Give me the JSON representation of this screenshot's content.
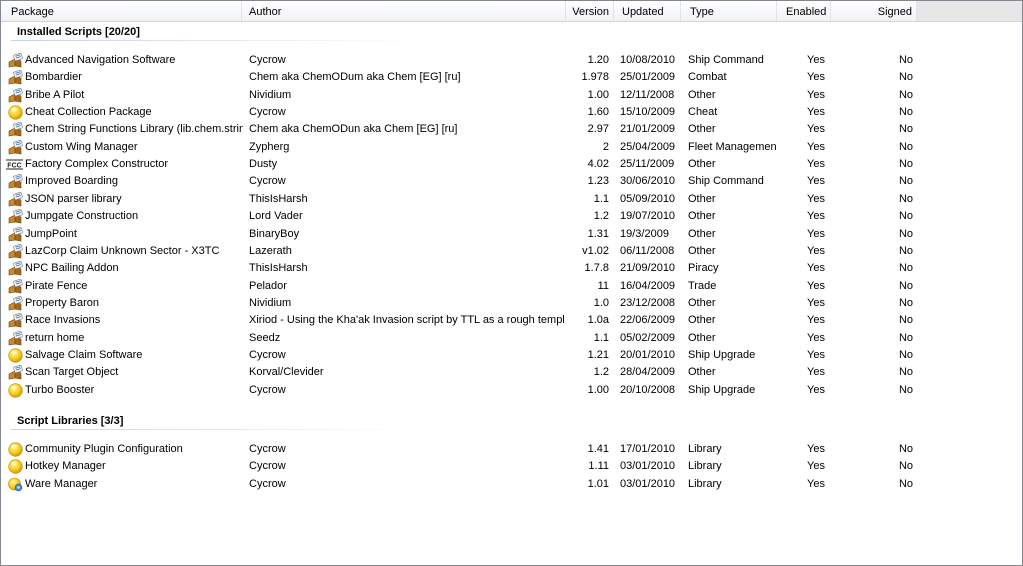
{
  "columns": {
    "package": "Package",
    "author": "Author",
    "version": "Version",
    "updated": "Updated",
    "type": "Type",
    "enabled": "Enabled",
    "signed": "Signed"
  },
  "groups": [
    {
      "title": "Installed Scripts [20/20]",
      "rows": [
        {
          "icon": "script-package-icon",
          "name": "Advanced Navigation Software",
          "author": "Cycrow",
          "version": "1.20",
          "updated": "10/08/2010",
          "type": "Ship Command",
          "enabled": "Yes",
          "signed": "No"
        },
        {
          "icon": "script-package-icon",
          "name": "Bombardier",
          "author": "Chem aka ChemODum aka Chem [EG] [ru]",
          "version": "1.978",
          "updated": "25/01/2009",
          "type": "Combat",
          "enabled": "Yes",
          "signed": "No"
        },
        {
          "icon": "script-package-icon",
          "name": "Bribe A Pilot",
          "author": "Nividium",
          "version": "1.00",
          "updated": "12/11/2008",
          "type": "Other",
          "enabled": "Yes",
          "signed": "No"
        },
        {
          "icon": "yellow-smiley-icon",
          "name": "Cheat Collection Package",
          "author": "Cycrow",
          "version": "1.60",
          "updated": "15/10/2009",
          "type": "Cheat",
          "enabled": "Yes",
          "signed": "No"
        },
        {
          "icon": "script-package-icon",
          "name": "Chem String Functions Library (lib.chem.strings)",
          "author": "Chem aka ChemODun aka Chem [EG] [ru]",
          "version": "2.97",
          "updated": "21/01/2009",
          "type": "Other",
          "enabled": "Yes",
          "signed": "No"
        },
        {
          "icon": "script-package-icon",
          "name": "Custom Wing Manager",
          "author": "Zypherg",
          "version": "2",
          "updated": "25/04/2009",
          "type": "Fleet Management",
          "enabled": "Yes",
          "signed": "No"
        },
        {
          "icon": "fcc-logo-icon",
          "name": "Factory Complex Constructor",
          "author": "Dusty",
          "version": "4.02",
          "updated": "25/11/2009",
          "type": "Other",
          "enabled": "Yes",
          "signed": "No"
        },
        {
          "icon": "script-package-icon",
          "name": "Improved Boarding",
          "author": "Cycrow",
          "version": "1.23",
          "updated": "30/06/2010",
          "type": "Ship Command",
          "enabled": "Yes",
          "signed": "No"
        },
        {
          "icon": "script-package-icon",
          "name": "JSON parser library",
          "author": "ThisIsHarsh",
          "version": "1.1",
          "updated": "05/09/2010",
          "type": "Other",
          "enabled": "Yes",
          "signed": "No"
        },
        {
          "icon": "script-package-icon",
          "name": "Jumpgate Construction",
          "author": "Lord Vader",
          "version": "1.2",
          "updated": "19/07/2010",
          "type": "Other",
          "enabled": "Yes",
          "signed": "No"
        },
        {
          "icon": "script-package-icon",
          "name": "JumpPoint",
          "author": "BinaryBoy",
          "version": "1.31",
          "updated": "19/3/2009",
          "type": "Other",
          "enabled": "Yes",
          "signed": "No"
        },
        {
          "icon": "script-package-icon",
          "name": "LazCorp Claim Unknown Sector - X3TC",
          "author": "Lazerath",
          "version": "v1.02",
          "updated": "06/11/2008",
          "type": "Other",
          "enabled": "Yes",
          "signed": "No"
        },
        {
          "icon": "script-package-icon",
          "name": "NPC Bailing Addon",
          "author": "ThisIsHarsh",
          "version": "1.7.8",
          "updated": "21/09/2010",
          "type": "Piracy",
          "enabled": "Yes",
          "signed": "No"
        },
        {
          "icon": "script-package-icon",
          "name": "Pirate Fence",
          "author": "Pelador",
          "version": "11",
          "updated": "16/04/2009",
          "type": "Trade",
          "enabled": "Yes",
          "signed": "No"
        },
        {
          "icon": "script-package-icon",
          "name": "Property Baron",
          "author": "Nividium",
          "version": "1.0",
          "updated": "23/12/2008",
          "type": "Other",
          "enabled": "Yes",
          "signed": "No"
        },
        {
          "icon": "script-package-icon",
          "name": "Race Invasions",
          "author": "Xiriod - Using the Kha'ak Invasion script by TTL as a rough template.",
          "version": "1.0a",
          "updated": "22/06/2009",
          "type": "Other",
          "enabled": "Yes",
          "signed": "No"
        },
        {
          "icon": "script-package-icon",
          "name": "return home",
          "author": "Seedz",
          "version": "1.1",
          "updated": "05/02/2009",
          "type": "Other",
          "enabled": "Yes",
          "signed": "No"
        },
        {
          "icon": "yellow-smiley-icon",
          "name": "Salvage Claim Software",
          "author": "Cycrow",
          "version": "1.21",
          "updated": "20/01/2010",
          "type": "Ship Upgrade",
          "enabled": "Yes",
          "signed": "No"
        },
        {
          "icon": "script-package-icon",
          "name": "Scan Target Object",
          "author": "Korval/Clevider",
          "version": "1.2",
          "updated": "28/04/2009",
          "type": "Other",
          "enabled": "Yes",
          "signed": "No"
        },
        {
          "icon": "yellow-smiley-icon",
          "name": "Turbo Booster",
          "author": "Cycrow",
          "version": "1.00",
          "updated": "20/10/2008",
          "type": "Ship Upgrade",
          "enabled": "Yes",
          "signed": "No"
        }
      ]
    },
    {
      "title": "Script Libraries [3/3]",
      "rows": [
        {
          "icon": "yellow-smiley-icon",
          "name": "Community Plugin Configuration",
          "author": "Cycrow",
          "version": "1.41",
          "updated": "17/01/2010",
          "type": "Library",
          "enabled": "Yes",
          "signed": "No"
        },
        {
          "icon": "yellow-smiley-icon",
          "name": "Hotkey Manager",
          "author": "Cycrow",
          "version": "1.11",
          "updated": "03/01/2010",
          "type": "Library",
          "enabled": "Yes",
          "signed": "No"
        },
        {
          "icon": "ware-manager-icon",
          "name": "Ware Manager",
          "author": "Cycrow",
          "version": "1.01",
          "updated": "03/01/2010",
          "type": "Library",
          "enabled": "Yes",
          "signed": "No"
        }
      ]
    }
  ]
}
